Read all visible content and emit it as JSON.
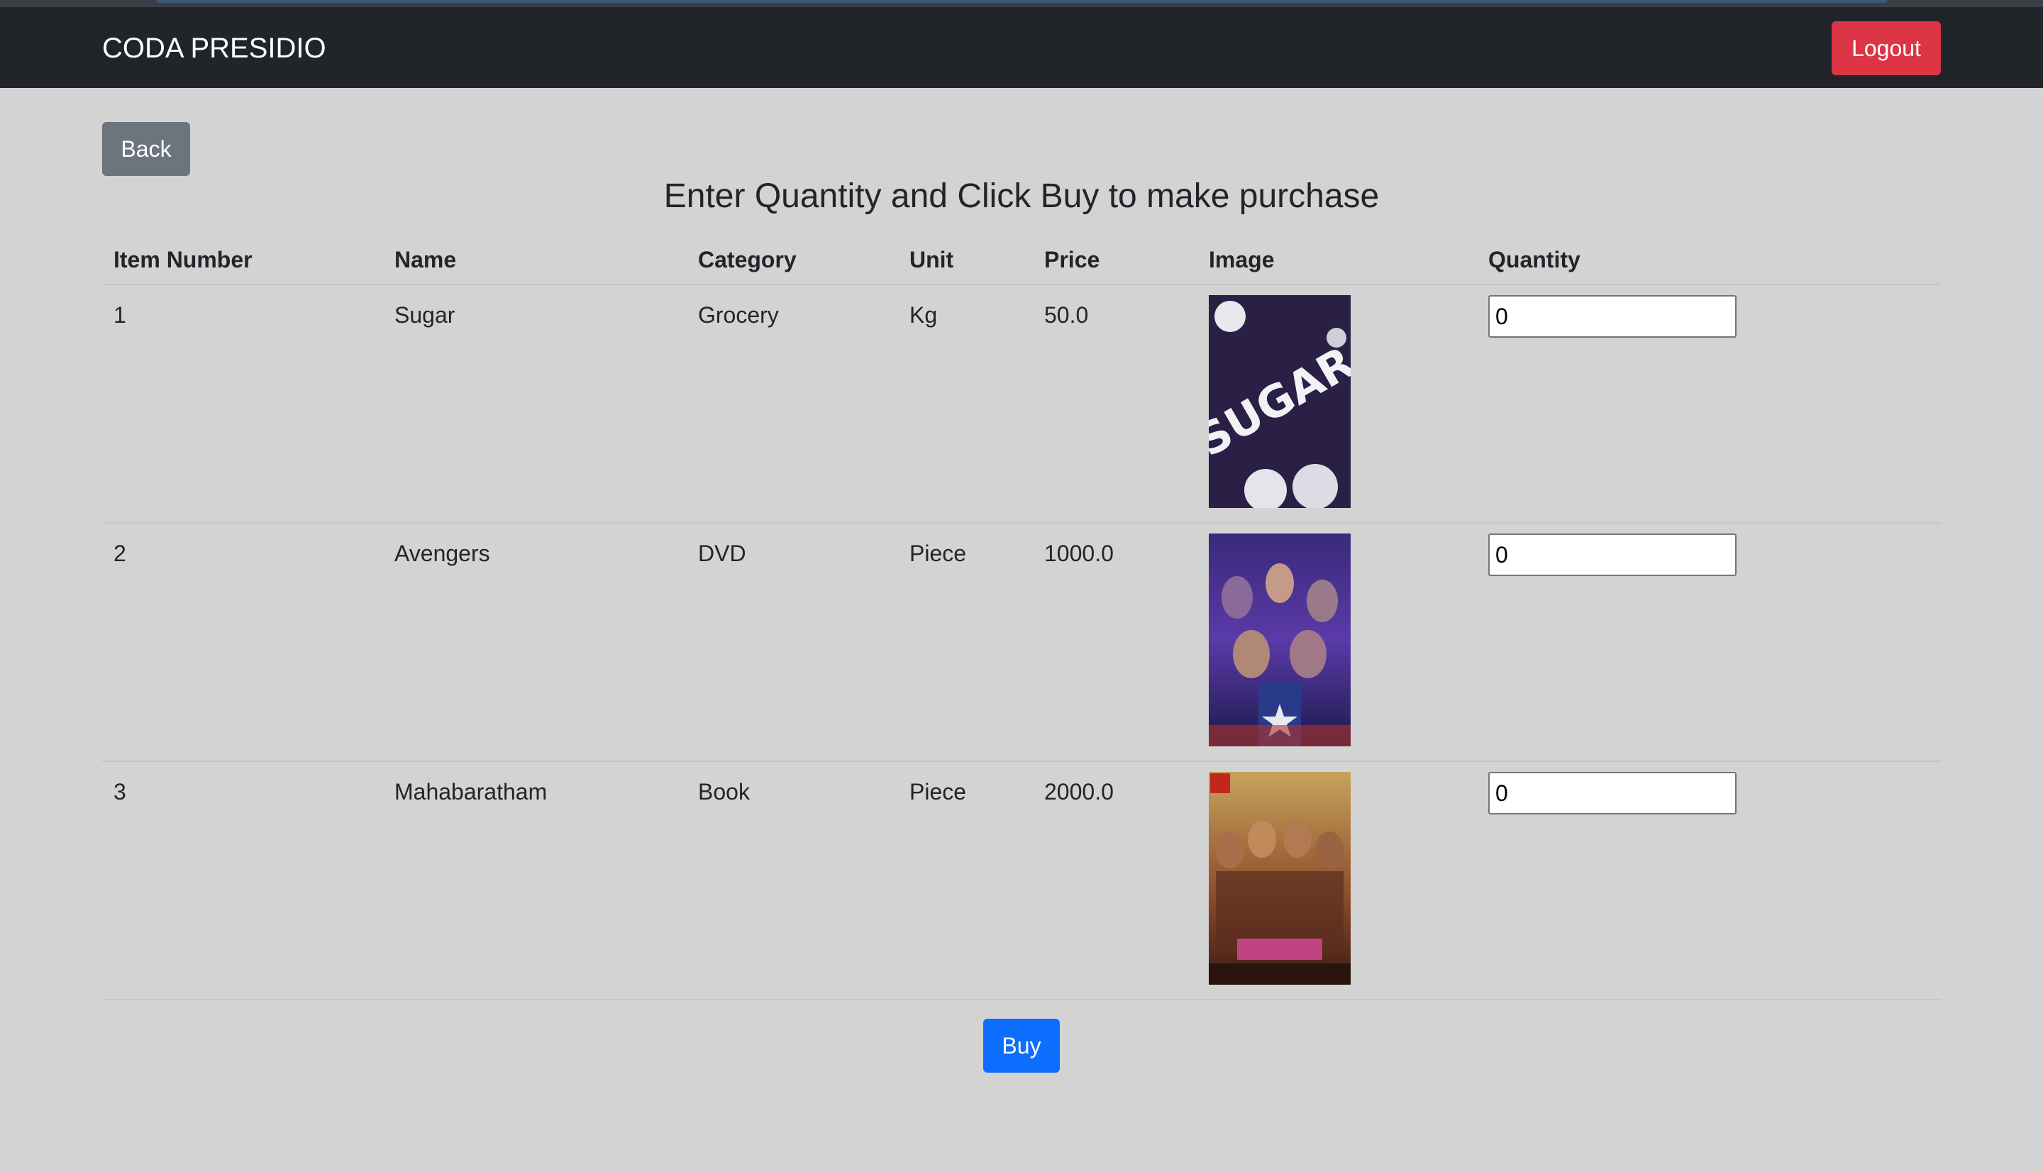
{
  "navbar": {
    "brand": "CODA PRESIDIO",
    "logout_label": "Logout"
  },
  "back_label": "Back",
  "heading": "Enter Quantity and Click Buy to make purchase",
  "table": {
    "headers": [
      "Item Number",
      "Name",
      "Category",
      "Unit",
      "Price",
      "Image",
      "Quantity"
    ],
    "rows": [
      {
        "number": "1",
        "name": "Sugar",
        "category": "Grocery",
        "unit": "Kg",
        "price": "50.0",
        "image": "sugar-image",
        "quantity": "0"
      },
      {
        "number": "2",
        "name": "Avengers",
        "category": "DVD",
        "unit": "Piece",
        "price": "1000.0",
        "image": "avengers-poster-image",
        "quantity": "0"
      },
      {
        "number": "3",
        "name": "Mahabaratham",
        "category": "Book",
        "unit": "Piece",
        "price": "2000.0",
        "image": "mahabaratham-cover-image",
        "quantity": "0"
      }
    ]
  },
  "buy_label": "Buy",
  "colors": {
    "navbar": "#212529",
    "logout": "#dc3545",
    "back": "#6c757d",
    "buy": "#0d6efd",
    "page_bg": "#d3d3d3"
  }
}
